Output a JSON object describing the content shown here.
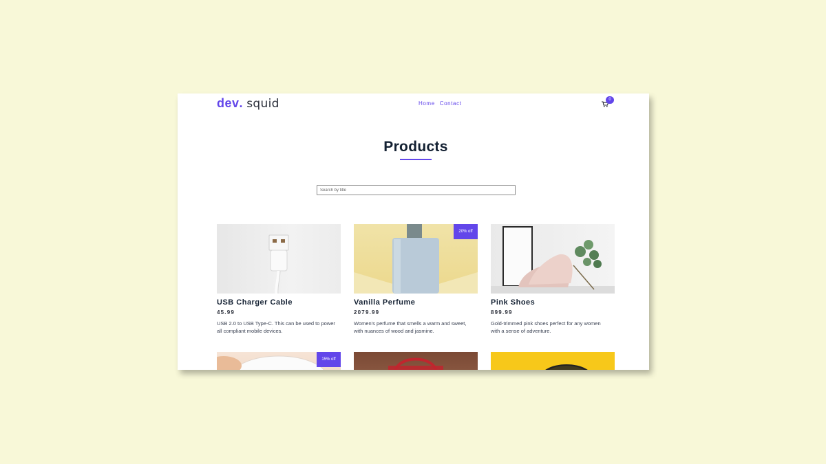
{
  "navbar": {
    "logo_brand": "dev",
    "logo_dot": ".",
    "logo_rest": " squid",
    "links": [
      "Home",
      "Contact"
    ],
    "cart_count": "0"
  },
  "page": {
    "title": "Products",
    "search_placeholder": "Search by title"
  },
  "products": [
    {
      "title": "USB Charger Cable",
      "price": "45.99",
      "description": "USB 2.0 to USB Type-C. This can be used to power all compliant mobile devices.",
      "badge": "",
      "image_icon": "usb-cable-photo"
    },
    {
      "title": "Vanilla Perfume",
      "price": "2079.99",
      "description": "Women's perfume that smells a warm and sweet, with nuances of wood and jasmine.",
      "badge": "20% off",
      "image_icon": "perfume-bottle-photo"
    },
    {
      "title": "Pink Shoes",
      "price": "899.99",
      "description": "Gold-trimmed pink shoes perfect for any women with a sense of adventure.",
      "badge": "",
      "image_icon": "pink-shoes-photo"
    },
    {
      "badge": "15% off",
      "image_icon": "plate-photo"
    },
    {
      "badge": "",
      "image_icon": "handbag-photo"
    },
    {
      "badge": "",
      "image_icon": "yellow-product-photo"
    }
  ],
  "colors": {
    "accent": "#6246ea",
    "heading": "#132032",
    "background": "#f8f8d8"
  }
}
